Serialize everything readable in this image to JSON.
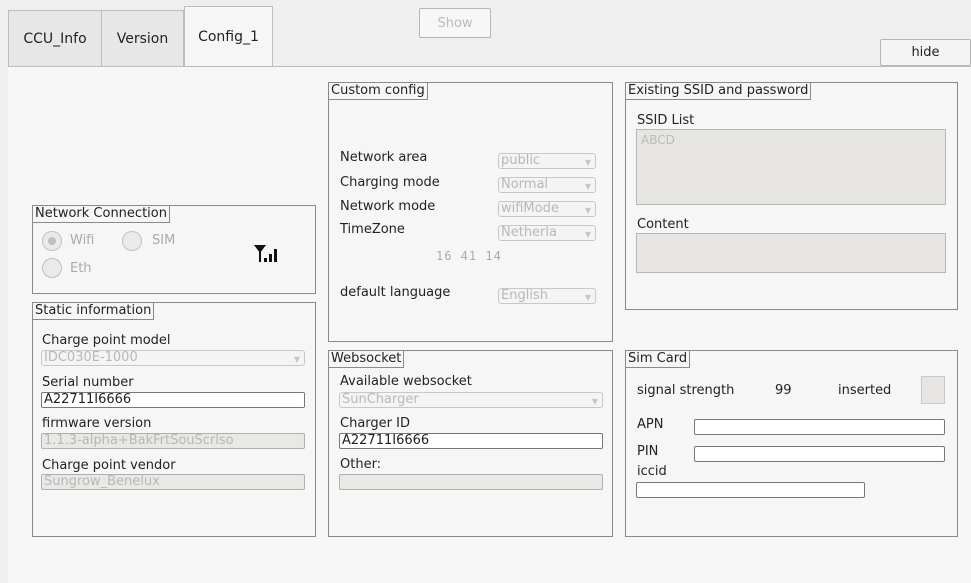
{
  "tabs": [
    {
      "label": "CCU_Info"
    },
    {
      "label": "Version"
    },
    {
      "label": "Config_1"
    }
  ],
  "buttons": {
    "show": "Show",
    "hide": "hide"
  },
  "network_connection": {
    "title": "Network Connection",
    "options": {
      "wifi": "Wifi",
      "sim": "SIM",
      "eth": "Eth"
    },
    "selected": "Wifi"
  },
  "static_information": {
    "title": "Static information",
    "charge_point_model_label": "Charge point model",
    "charge_point_model_value": "IDC030E-1000",
    "serial_number_label": "Serial number",
    "serial_number_value": "A22711I6666",
    "firmware_version_label": "firmware version",
    "firmware_version_value": "1.1.3-alpha+BakFrtSouScrlso",
    "charge_point_vendor_label": "Charge point vendor",
    "charge_point_vendor_value": "Sungrow_Benelux"
  },
  "custom_config": {
    "title": "Custom config",
    "network_area_label": "Network area",
    "network_area_value": "public",
    "charging_mode_label": "Charging mode",
    "charging_mode_value": "Normal",
    "network_mode_label": "Network mode",
    "network_mode_value": "wifiMode",
    "timezone_label": "TimeZone",
    "timezone_value": "Netherla",
    "clock": "16 41 14",
    "default_language_label": "default language",
    "default_language_value": "English"
  },
  "websocket": {
    "title": "Websocket",
    "available_label": "Available websocket",
    "available_value": "SunCharger",
    "charger_id_label": "Charger ID",
    "charger_id_value": "A22711I6666",
    "other_label": "Other:",
    "other_value": ""
  },
  "ssid": {
    "title": "Existing SSID and password",
    "list_label": "SSID List",
    "list_items": [
      "ABCD"
    ],
    "content_label": "Content",
    "content_value": ""
  },
  "sim_card": {
    "title": "Sim Card",
    "signal_label": "signal strength",
    "signal_value": "99",
    "inserted_label": "inserted",
    "apn_label": "APN",
    "pin_label": "PIN",
    "iccid_label": "iccid"
  },
  "icons": {
    "signal": "signal-strength-icon"
  }
}
